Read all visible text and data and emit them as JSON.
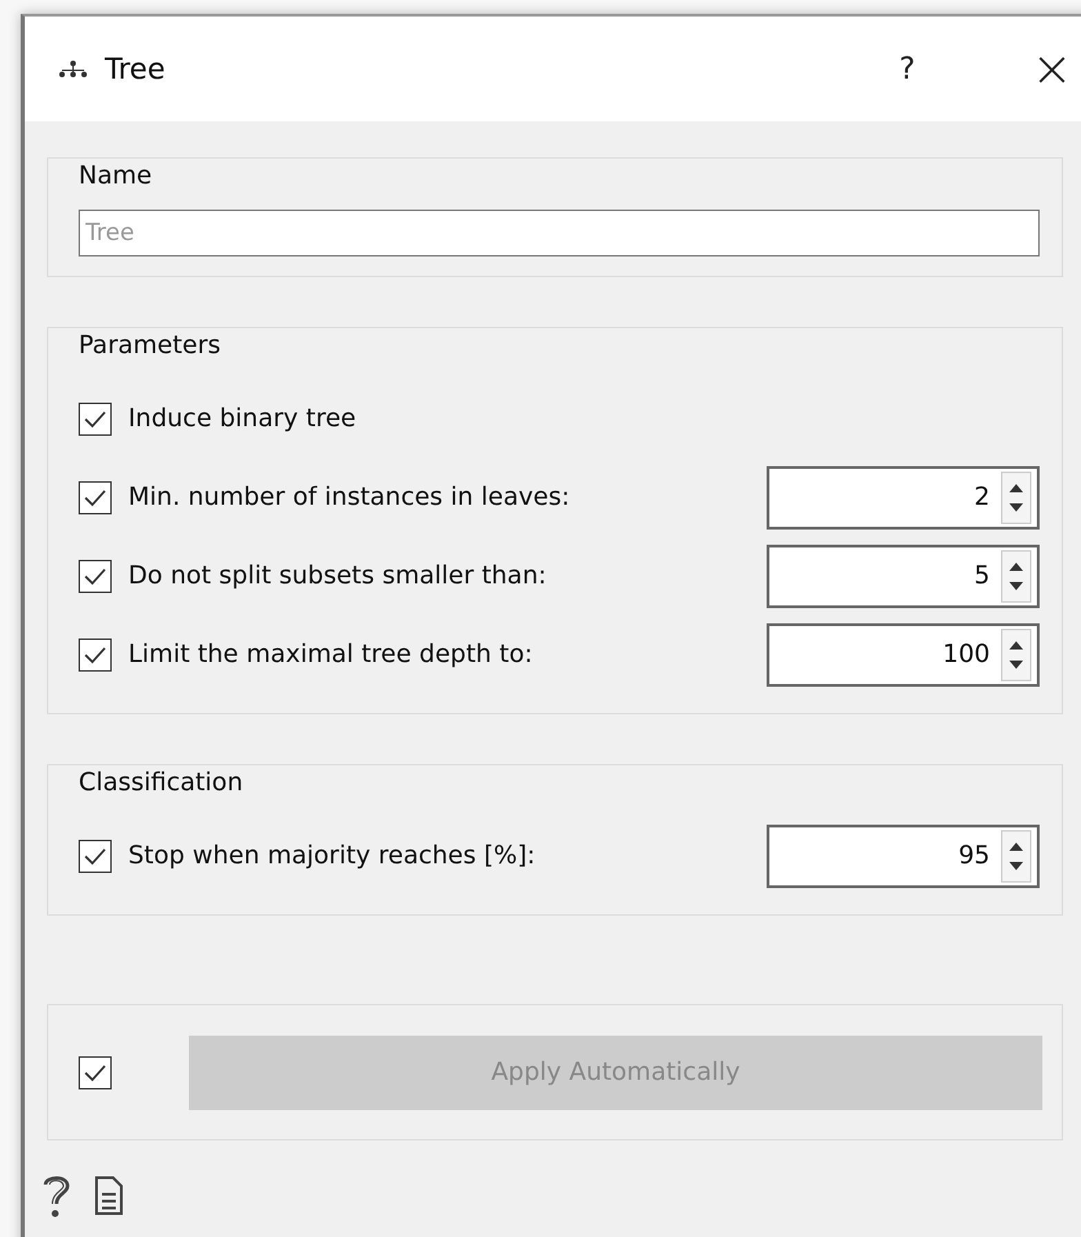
{
  "window": {
    "title": "Tree",
    "help": "?",
    "close": "×"
  },
  "name_group": {
    "title": "Name",
    "field": {
      "placeholder": "Tree"
    }
  },
  "parameters": {
    "title": "Parameters",
    "options": [
      {
        "kind": "checkbox",
        "label": "Induce binary tree",
        "checked": true
      },
      {
        "kind": "spin",
        "label": "Min. number of instances in leaves:",
        "checked": true,
        "value": "2"
      },
      {
        "kind": "spin",
        "label": "Do not split subsets smaller than:",
        "checked": true,
        "value": "5"
      },
      {
        "kind": "spin",
        "label": "Limit the maximal tree depth to:",
        "checked": true,
        "value": "100"
      }
    ]
  },
  "classification": {
    "title": "Classification",
    "options": [
      {
        "kind": "spin",
        "label": "Stop when majority reaches [%]:",
        "checked": true,
        "value": "95"
      }
    ]
  },
  "apply": {
    "checked": true,
    "button": {
      "label": "Apply Automatically",
      "disabled": true
    }
  }
}
